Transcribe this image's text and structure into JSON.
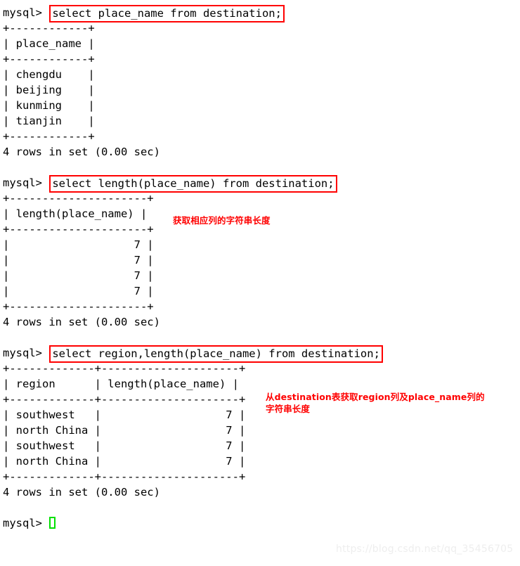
{
  "terminal": {
    "prompt": "mysql> ",
    "blocks": [
      {
        "command": "select place_name from destination;",
        "table": {
          "border_top": "+------------+",
          "header": "| place_name |",
          "border_mid": "+------------+",
          "rows": [
            "| chengdu    |",
            "| beijing    |",
            "| kunming    |",
            "| tianjin    |"
          ],
          "border_bottom": "+------------+"
        },
        "status": "4 rows in set (0.00 sec)"
      },
      {
        "command": "select length(place_name) from destination;",
        "table": {
          "border_top": "+---------------------+",
          "header": "| length(place_name) |",
          "border_mid": "+---------------------+",
          "rows": [
            "|                   7 |",
            "|                   7 |",
            "|                   7 |",
            "|                   7 |"
          ],
          "border_bottom": "+---------------------+"
        },
        "status": "4 rows in set (0.00 sec)"
      },
      {
        "command": "select region,length(place_name) from destination;",
        "table": {
          "border_top": "+-------------+---------------------+",
          "header": "| region      | length(place_name) |",
          "border_mid": "+-------------+---------------------+",
          "rows": [
            "| southwest   |                   7 |",
            "| north China |                   7 |",
            "| southwest   |                   7 |",
            "| north China |                   7 |"
          ],
          "border_bottom": "+-------------+---------------------+"
        },
        "status": "4 rows in set (0.00 sec)"
      }
    ],
    "final_prompt": "mysql> "
  },
  "annotations": [
    {
      "text": "获取相应列的字符串长度"
    },
    {
      "text": "从destination表获取region列及place_name列的\n字符串长度"
    }
  ],
  "watermark": "https://blog.csdn.net/qq_35456705",
  "colors": {
    "annotation_red": "#ff0000",
    "box_red": "#ff0000",
    "cursor_green": "#00e000",
    "text_black": "#000000",
    "watermark_gray": "#eeeeee"
  }
}
